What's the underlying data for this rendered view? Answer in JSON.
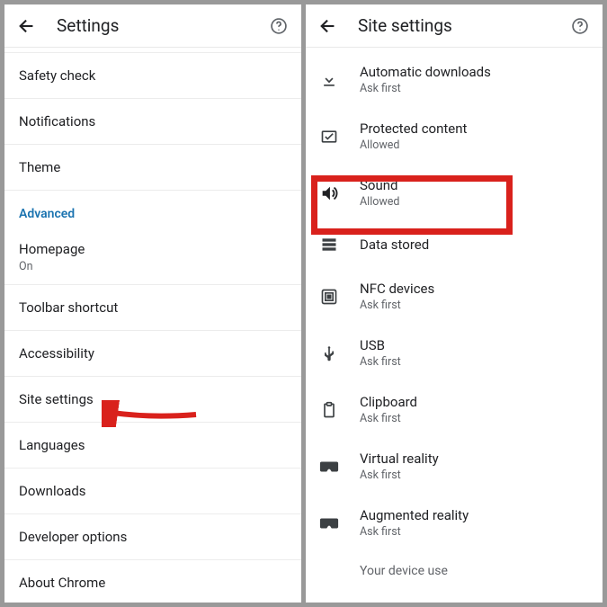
{
  "left": {
    "header": {
      "title": "Settings"
    },
    "items": {
      "safety_check": "Safety check",
      "notifications": "Notifications",
      "theme": "Theme",
      "advanced": "Advanced",
      "homepage": {
        "label": "Homepage",
        "sub": "On"
      },
      "toolbar": "Toolbar shortcut",
      "accessibility": "Accessibility",
      "site_settings": "Site settings",
      "languages": "Languages",
      "downloads": "Downloads",
      "dev_options": "Developer options",
      "about": "About Chrome"
    }
  },
  "right": {
    "header": {
      "title": "Site settings"
    },
    "items": {
      "auto_dl": {
        "label": "Automatic downloads",
        "sub": "Ask first"
      },
      "protected": {
        "label": "Protected content",
        "sub": "Allowed"
      },
      "sound": {
        "label": "Sound",
        "sub": "Allowed"
      },
      "data_stored": {
        "label": "Data stored"
      },
      "nfc": {
        "label": "NFC devices",
        "sub": "Ask first"
      },
      "usb": {
        "label": "USB",
        "sub": "Ask first"
      },
      "clipboard": {
        "label": "Clipboard",
        "sub": "Ask first"
      },
      "vr": {
        "label": "Virtual reality",
        "sub": "Ask first"
      },
      "ar": {
        "label": "Augmented reality",
        "sub": "Ask first"
      },
      "device_use": {
        "label": "Your device use"
      }
    }
  }
}
